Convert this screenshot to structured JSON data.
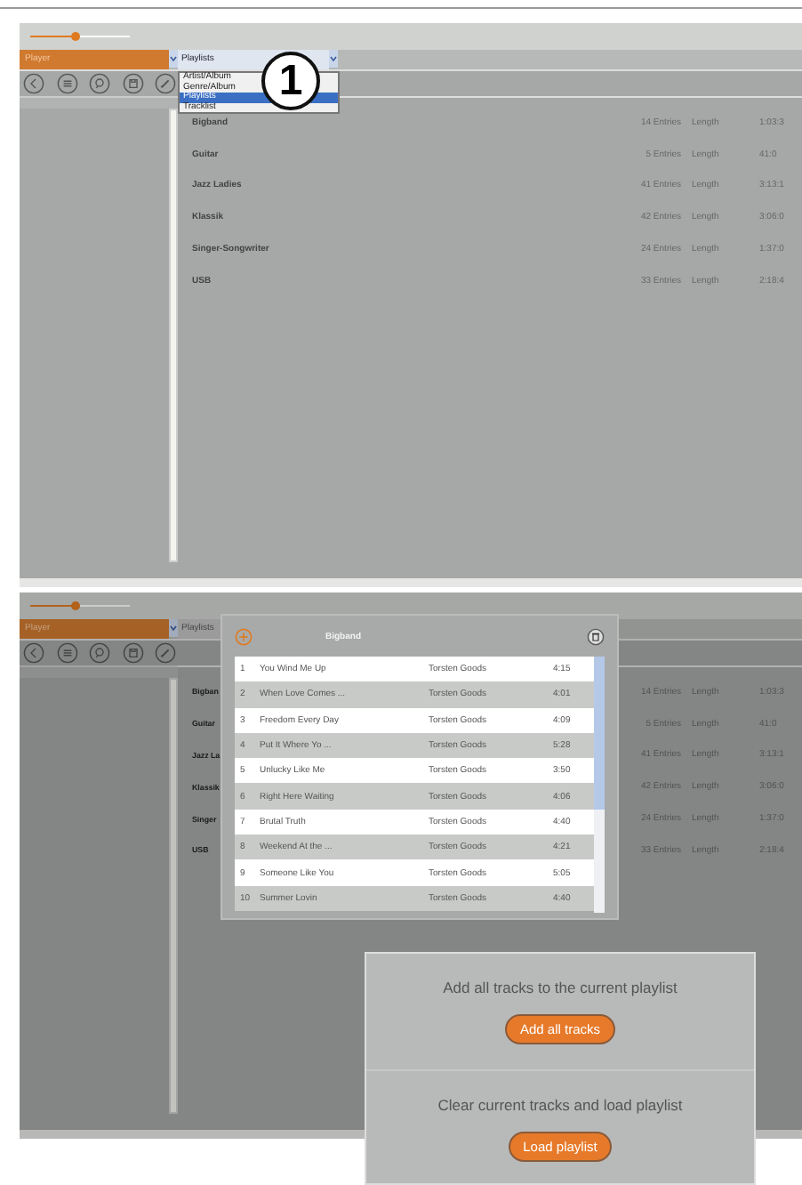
{
  "screens": [
    {
      "slider": {
        "level": 0.46
      },
      "mode_tab": {
        "label": "Player"
      },
      "view_select": {
        "value": "Playlists",
        "open": true,
        "options": [
          {
            "label": "Artist/Album",
            "selected": false
          },
          {
            "label": "Genre/Album",
            "selected": false
          },
          {
            "label": "Playlists",
            "selected": true
          },
          {
            "label": "Tracklist",
            "selected": false
          }
        ]
      },
      "callout": "1",
      "playlists": [
        {
          "name": "Bigband",
          "entries": "14 Entries",
          "length_label": "Length",
          "length": "1:03:3"
        },
        {
          "name": "Guitar",
          "entries": "5 Entries",
          "length_label": "Length",
          "length": "41:0"
        },
        {
          "name": "Jazz Ladies",
          "entries": "41 Entries",
          "length_label": "Length",
          "length": "3:13:1"
        },
        {
          "name": "Klassik",
          "entries": "42 Entries",
          "length_label": "Length",
          "length": "3:06:0"
        },
        {
          "name": "Singer-Songwriter",
          "entries": "24 Entries",
          "length_label": "Length",
          "length": "1:37:0"
        },
        {
          "name": "USB",
          "entries": "33 Entries",
          "length_label": "Length",
          "length": "2:18:4"
        }
      ]
    },
    {
      "slider": {
        "level": 0.46
      },
      "mode_tab": {
        "label": "Player"
      },
      "view_select": {
        "value": "Playlists",
        "open": false
      },
      "playlists": [
        {
          "name": "Bigban",
          "entries": "14 Entries",
          "length_label": "Length",
          "length": "1:03:3"
        },
        {
          "name": "Guitar",
          "entries": "5 Entries",
          "length_label": "Length",
          "length": "41:0"
        },
        {
          "name": "Jazz La",
          "entries": "41 Entries",
          "length_label": "Length",
          "length": "3:13:1"
        },
        {
          "name": "Klassik",
          "entries": "42 Entries",
          "length_label": "Length",
          "length": "3:06:0"
        },
        {
          "name": "Singer",
          "entries": "24 Entries",
          "length_label": "Length",
          "length": "1:37:0"
        },
        {
          "name": "USB",
          "entries": "33 Entries",
          "length_label": "Length",
          "length": "2:18:4"
        }
      ],
      "dialog": {
        "title": "Bigband",
        "tracks": [
          {
            "number": "1",
            "title": "You Wind Me Up",
            "artist": "Torsten Goods",
            "time": "4:15"
          },
          {
            "number": "2",
            "title": "When Love Comes ...",
            "artist": "Torsten Goods",
            "time": "4:01"
          },
          {
            "number": "3",
            "title": "Freedom Every Day",
            "artist": "Torsten Goods",
            "time": "4:09"
          },
          {
            "number": "4",
            "title": "Put It Where Yo ...",
            "artist": "Torsten Goods",
            "time": "5:28"
          },
          {
            "number": "5",
            "title": "Unlucky Like Me",
            "artist": "Torsten Goods",
            "time": "3:50"
          },
          {
            "number": "6",
            "title": "Right Here Waiting",
            "artist": "Torsten Goods",
            "time": "4:06"
          },
          {
            "number": "7",
            "title": "Brutal Truth",
            "artist": "Torsten Goods",
            "time": "4:40"
          },
          {
            "number": "8",
            "title": "Weekend At the ...",
            "artist": "Torsten Goods",
            "time": "4:21"
          },
          {
            "number": "9",
            "title": "Someone Like You",
            "artist": "Torsten Goods",
            "time": "5:05"
          },
          {
            "number": "10",
            "title": "Summer Lovin",
            "artist": "Torsten Goods",
            "time": "4:40"
          }
        ]
      },
      "actions": [
        {
          "text": "Add all tracks to the current playlist",
          "button": "Add all tracks"
        },
        {
          "text": "Clear current tracks and load playlist",
          "button": "Load playlist"
        }
      ]
    }
  ]
}
